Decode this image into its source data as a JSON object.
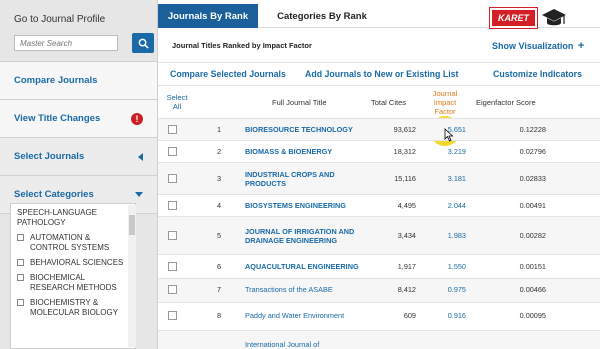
{
  "sidebar": {
    "profile_title": "Go to Journal Profile",
    "search_placeholder": "Master Search",
    "compare_journals": "Compare Journals",
    "view_title_changes": "View Title Changes",
    "select_journals": "Select Journals",
    "select_categories": "Select Categories",
    "categories": [
      {
        "label": "SPEECH-LANGUAGE PATHOLOGY",
        "checkbox": false
      },
      {
        "label": "AUTOMATION & CONTROL SYSTEMS",
        "checkbox": true
      },
      {
        "label": "BEHAVIORAL SCIENCES",
        "checkbox": true
      },
      {
        "label": "BIOCHEMICAL RESEARCH METHODS",
        "checkbox": true
      },
      {
        "label": "BIOCHEMISTRY & MOLECULAR BIOLOGY",
        "checkbox": true
      }
    ]
  },
  "tabs": {
    "by_rank": "Journals By Rank",
    "categories_by_rank": "Categories By Rank"
  },
  "logo": {
    "text": "KARET"
  },
  "main": {
    "subtitle": "Journal Titles Ranked by Impact Factor",
    "show_visualization": "Show Visualization",
    "compare_selected": "Compare Selected Journals",
    "add_journals": "Add Journals to New or Existing List",
    "customize": "Customize Indicators"
  },
  "table": {
    "headers": {
      "select_all": "Select All",
      "title": "Full Journal Title",
      "total_cites": "Total Cites",
      "jif": "Journal Impact Factor",
      "eigen": "Eigenfactor Score"
    },
    "rows": [
      {
        "rank": "1",
        "title": "BIORESOURCE TECHNOLOGY",
        "cites": "93,612",
        "jif": "5.651",
        "eigen": "0.12228"
      },
      {
        "rank": "2",
        "title": "BIOMASS & BIOENERGY",
        "cites": "18,312",
        "jif": "3.219",
        "eigen": "0.02796"
      },
      {
        "rank": "3",
        "title": "INDUSTRIAL CROPS AND PRODUCTS",
        "cites": "15,116",
        "jif": "3.181",
        "eigen": "0.02833"
      },
      {
        "rank": "4",
        "title": "BIOSYSTEMS ENGINEERING",
        "cites": "4,495",
        "jif": "2.044",
        "eigen": "0.00491"
      },
      {
        "rank": "5",
        "title": "JOURNAL OF IRRIGATION AND DRAINAGE ENGINEERING",
        "cites": "3,434",
        "jif": "1.983",
        "eigen": "0.00282"
      },
      {
        "rank": "6",
        "title": "AQUACULTURAL ENGINEERING",
        "cites": "1,917",
        "jif": "1.550",
        "eigen": "0.00151"
      },
      {
        "rank": "7",
        "title": "Transactions of the ASABE",
        "cites": "8,412",
        "jif": "0.975",
        "eigen": "0.00466"
      },
      {
        "rank": "8",
        "title": "Paddy and Water Environment",
        "cites": "609",
        "jif": "0.916",
        "eigen": "0.00095"
      },
      {
        "rank": "",
        "title": "International Journal of",
        "cites": "",
        "jif": "",
        "eigen": ""
      }
    ]
  }
}
